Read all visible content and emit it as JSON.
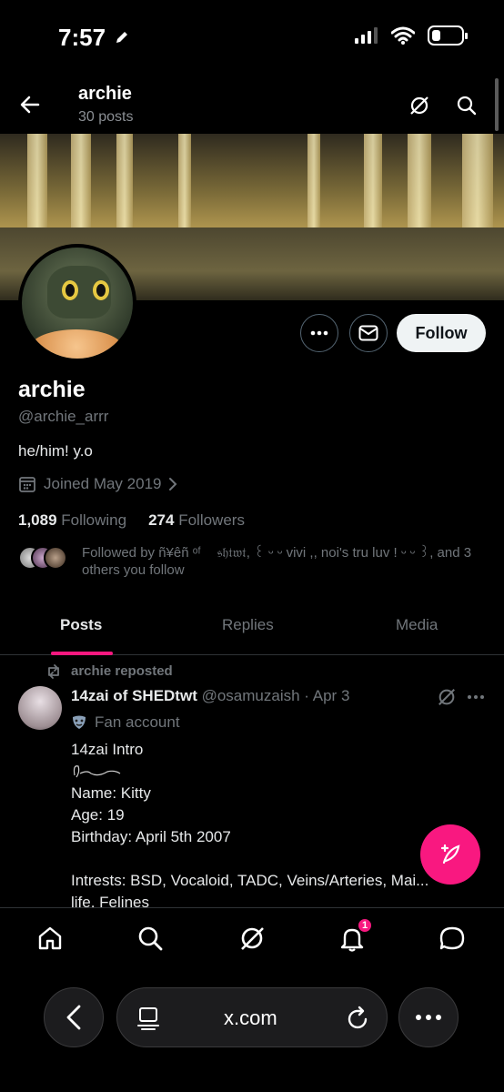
{
  "status_bar": {
    "time": "7:57"
  },
  "header": {
    "title": "archie",
    "subtitle": "30 posts"
  },
  "profile": {
    "name": "archie",
    "handle": "@archie_arrr",
    "bio": "he/him! y.o",
    "joined": "Joined May 2019",
    "following_count": "1,089",
    "following_label": "Following",
    "followers_count": "274",
    "followers_label": "Followers",
    "followed_by": "Followed by ñ¥êñ ᵒᶠ ﾠ𝔰𝔥𝔱𝔴𝔱, ꒰ ᵕ ᵕ vivi ,, noi's tru luv ! ᵕ ᵕ ꒱, and 3 others you follow",
    "follow_button": "Follow"
  },
  "tabs": [
    {
      "label": "Posts",
      "active": true
    },
    {
      "label": "Replies",
      "active": false
    },
    {
      "label": "Media",
      "active": false
    }
  ],
  "post": {
    "repost_label": "archie reposted",
    "author_name": "14zai of SHEDtwt",
    "author_handle": "@osamuzaish",
    "date": "Apr 3",
    "account_label": "Fan account",
    "lines": [
      "14zai Intro",
      "",
      "Name: Kitty",
      "Age: 19",
      "Birthday: April 5th 2007",
      "",
      "Intrests: BSD, Vocaloid, TADC, Veins/Arteries, Mai...",
      "life, Felines"
    ]
  },
  "bottom_nav": {
    "items": [
      "home-icon",
      "search-icon",
      "grok-icon",
      "notifications-icon",
      "messages-icon"
    ],
    "notification_badge": "1"
  },
  "browser": {
    "url": "x.com"
  },
  "colors": {
    "accent": "#f91880",
    "muted": "#71767b",
    "background": "#000000",
    "text": "#e7e9ea"
  }
}
